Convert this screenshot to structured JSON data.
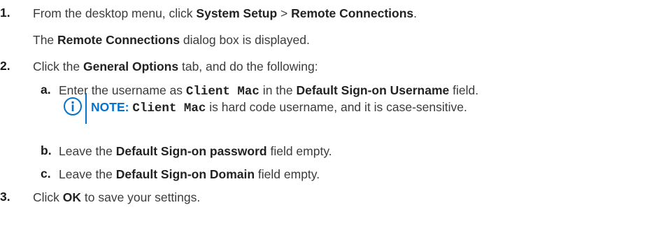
{
  "steps": [
    {
      "num": "1.",
      "pre": "From the desktop menu, click ",
      "b1": "System Setup",
      "mid": " > ",
      "b2": "Remote Connections",
      "post": ".",
      "result_pre": "The ",
      "result_b": "Remote Connections",
      "result_post": " dialog box is displayed."
    },
    {
      "num": "2.",
      "pre": "Click the ",
      "b": "General Options",
      "post": " tab, and do the following:",
      "substeps": [
        {
          "letter": "a.",
          "pre": "Enter the username as ",
          "code": "Client Mac",
          "mid": " in the ",
          "b": "Default Sign-on Username",
          "post": " field."
        },
        {
          "letter": "b.",
          "pre": "Leave the ",
          "b": "Default Sign-on password",
          "post": " field empty."
        },
        {
          "letter": "c.",
          "pre": "Leave the ",
          "b": "Default Sign-on Domain",
          "post": " field empty."
        }
      ],
      "note": {
        "icon": "info-icon",
        "label": "NOTE:",
        "code": "Client Mac",
        "text": " is hard code username, and it is case-sensitive."
      }
    },
    {
      "num": "3.",
      "pre": "Click ",
      "b": "OK",
      "post": " to save your settings."
    }
  ],
  "colors": {
    "accent": "#0672cb",
    "text": "#3b3b3b"
  }
}
